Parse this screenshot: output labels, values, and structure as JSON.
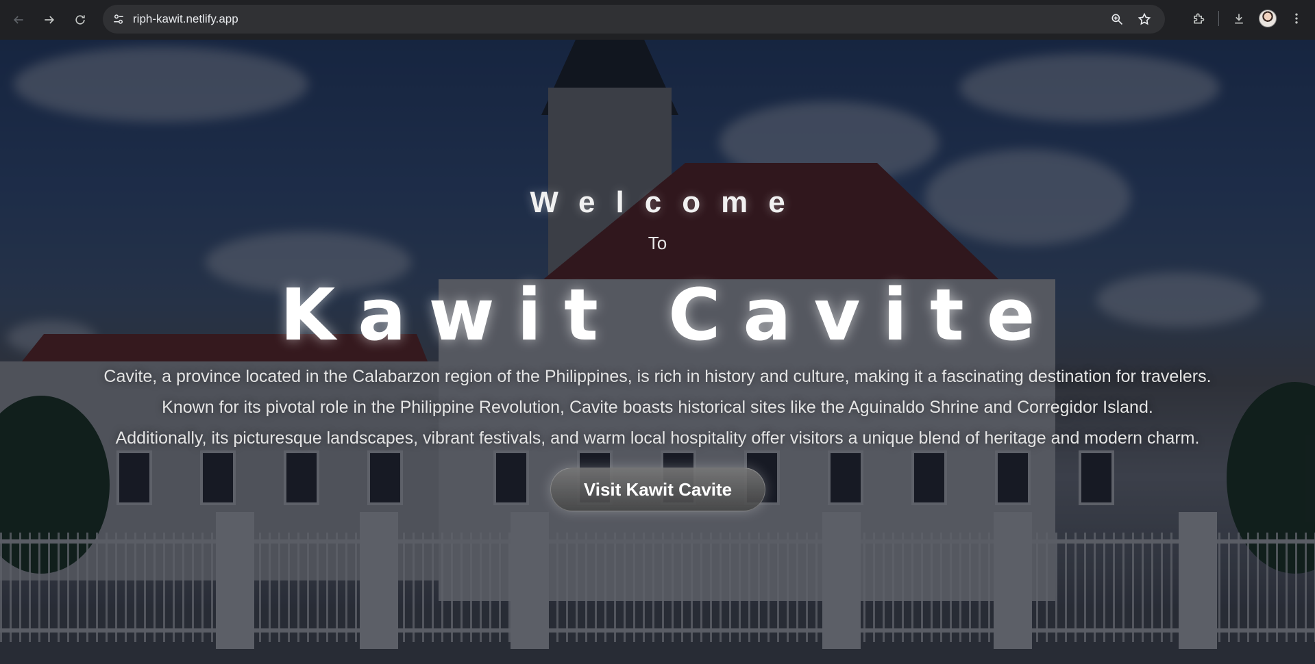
{
  "browser": {
    "url": "riph-kawit.netlify.app",
    "icons": {
      "back": "arrow-left-icon",
      "forward": "arrow-right-icon",
      "reload": "reload-icon",
      "site_info": "tune-icon",
      "zoom": "zoom-icon",
      "bookmark": "star-icon",
      "extensions": "puzzle-icon",
      "downloads": "download-icon",
      "profile": "avatar",
      "menu": "kebab-menu-icon"
    }
  },
  "hero": {
    "welcome": "Welcome",
    "to": "To",
    "place": "Kawit Cavite",
    "description_lines": [
      "Cavite, a province located in the Calabarzon region of the Philippines, is rich in history and culture, making it a fascinating destination for travelers.",
      "Known for its pivotal role in the Philippine Revolution, Cavite boasts historical sites like the Aguinaldo Shrine and Corregidor Island.",
      "Additionally, its picturesque landscapes, vibrant festivals, and warm local hospitality offer visitors a unique blend of heritage and modern charm."
    ],
    "cta_label": "Visit Kawit Cavite"
  },
  "colors": {
    "chrome_bg": "#202124",
    "omnibox_bg": "#303134",
    "overlay": "rgba(10,14,28,0.62)",
    "text": "#ffffff"
  }
}
